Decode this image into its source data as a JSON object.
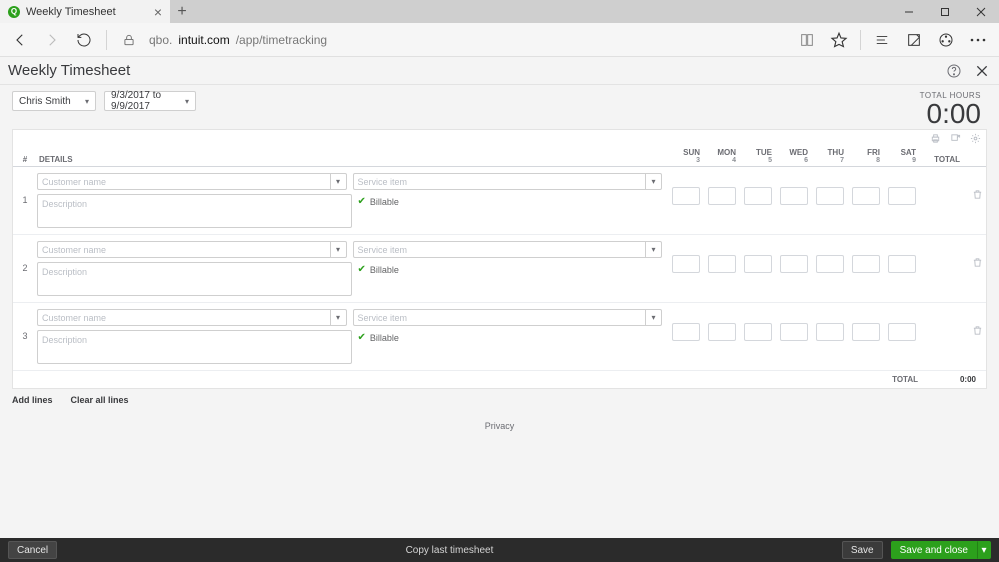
{
  "browser": {
    "tab_title": "Weekly Timesheet",
    "url_prefix": "qbo.",
    "url_host": "intuit.com",
    "url_path": "/app/timetracking"
  },
  "header": {
    "title": "Weekly Timesheet"
  },
  "filters": {
    "employee": "Chris Smith",
    "date_range": "9/3/2017 to 9/9/2017"
  },
  "total_hours": {
    "label": "TOTAL HOURS",
    "value": "0:00"
  },
  "columns": {
    "num": "#",
    "details": "DETAILS",
    "days": [
      {
        "name": "SUN",
        "date": "3"
      },
      {
        "name": "MON",
        "date": "4"
      },
      {
        "name": "TUE",
        "date": "5"
      },
      {
        "name": "WED",
        "date": "6"
      },
      {
        "name": "THU",
        "date": "7"
      },
      {
        "name": "FRI",
        "date": "8"
      },
      {
        "name": "SAT",
        "date": "9"
      }
    ],
    "total": "TOTAL"
  },
  "placeholders": {
    "customer": "Customer name",
    "service": "Service item",
    "description": "Description"
  },
  "labels": {
    "billable": "Billable",
    "total_row": "TOTAL",
    "total_value": "0:00",
    "add_lines": "Add lines",
    "clear_lines": "Clear all lines",
    "privacy": "Privacy"
  },
  "rows": [
    {
      "num": "1"
    },
    {
      "num": "2"
    },
    {
      "num": "3"
    }
  ],
  "footer": {
    "cancel": "Cancel",
    "copy": "Copy last timesheet",
    "save": "Save",
    "save_close": "Save and close"
  }
}
